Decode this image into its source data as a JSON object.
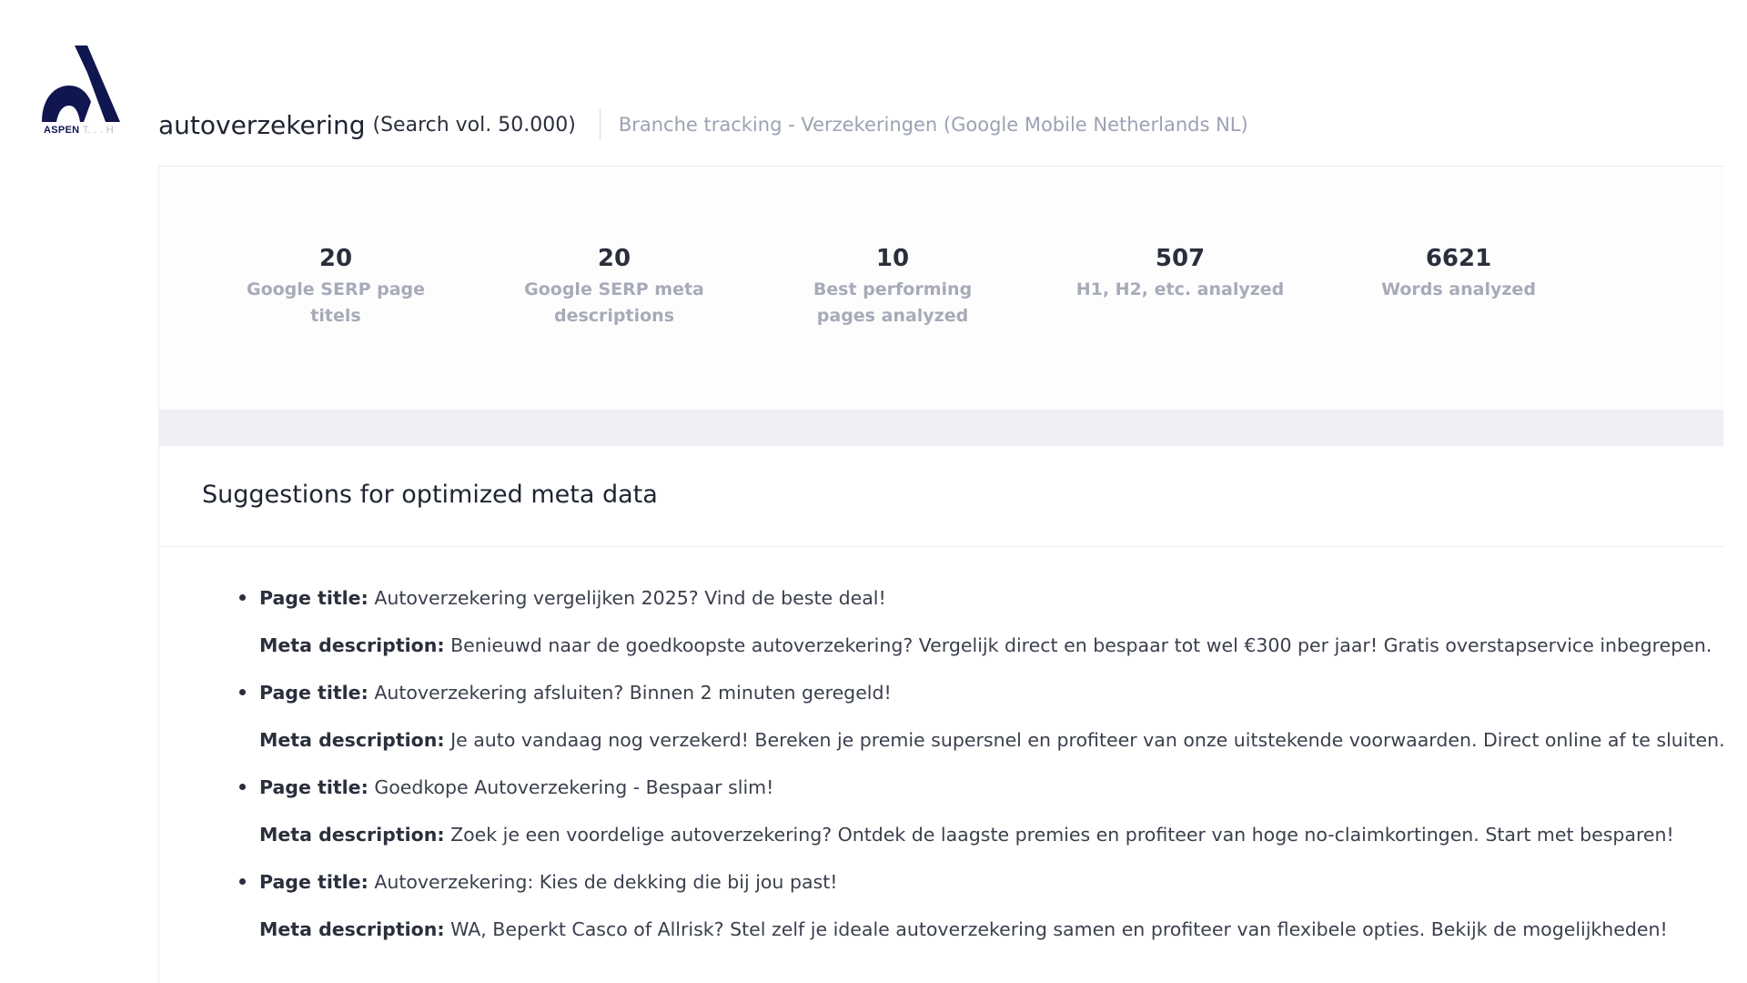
{
  "brand": {
    "logo_text": "ASPEN",
    "logo_text_faint": "T. . . H",
    "color": "#10164f"
  },
  "header": {
    "keyword": "autoverzekering",
    "volume": "(Search vol. 50.000)",
    "tracking": "Branche tracking - Verzekeringen (Google Mobile Netherlands NL)"
  },
  "stats": [
    {
      "value": "20",
      "label_line1": "Google SERP page",
      "label_line2": "titels"
    },
    {
      "value": "20",
      "label_line1": "Google SERP meta",
      "label_line2": "descriptions"
    },
    {
      "value": "10",
      "label_line1": "Best performing",
      "label_line2": "pages analyzed"
    },
    {
      "value": "507",
      "label_line1": "H1, H2, etc. analyzed",
      "label_line2": ""
    },
    {
      "value": "6621",
      "label_line1": "Words analyzed",
      "label_line2": ""
    }
  ],
  "suggestions": {
    "title": "Suggestions for optimized meta data",
    "page_title_label": "Page title:",
    "meta_description_label": "Meta description:",
    "items": [
      {
        "page_title": "Autoverzekering vergelijken 2025? Vind de beste deal!",
        "meta_description": "Benieuwd naar de goedkoopste autoverzekering? Vergelijk direct en bespaar tot wel €300 per jaar! Gratis overstapservice inbegrepen."
      },
      {
        "page_title": "Autoverzekering afsluiten? Binnen 2 minuten geregeld!",
        "meta_description": "Je auto vandaag nog verzekerd! Bereken je premie supersnel en profiteer van onze uitstekende voorwaarden. Direct online af te sluiten."
      },
      {
        "page_title": "Goedkope Autoverzekering - Bespaar slim!",
        "meta_description": "Zoek je een voordelige autoverzekering? Ontdek de laagste premies en profiteer van hoge no-claimkortingen. Start met besparen!"
      },
      {
        "page_title": "Autoverzekering: Kies de dekking die bij jou past!",
        "meta_description": "WA, Beperkt Casco of Allrisk? Stel zelf je ideale autoverzekering samen en profiteer van flexibele opties. Bekijk de mogelijkheden!"
      }
    ]
  }
}
